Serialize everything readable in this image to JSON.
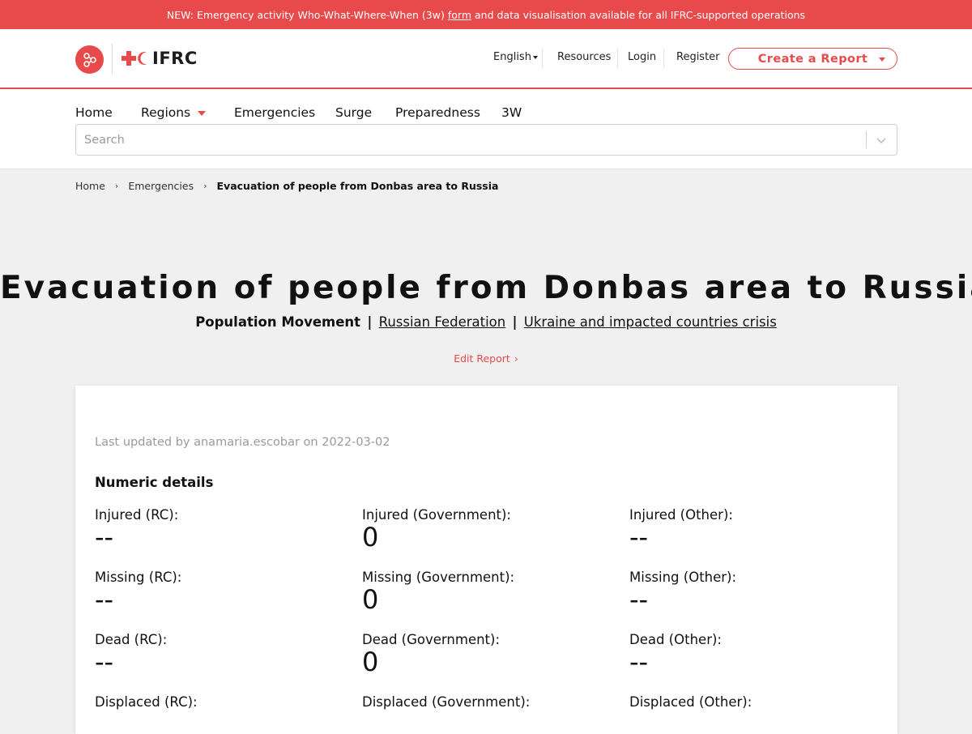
{
  "banner": {
    "prefix": "NEW: Emergency activity Who-What-Where-When (3w)",
    "link": "form",
    "suffix": "and data visualisation available for all IFRC-supported operations"
  },
  "header": {
    "logo_text": "IFRC",
    "language": "English",
    "resources": "Resources",
    "login": "Login",
    "register": "Register",
    "create_report": "Create a Report"
  },
  "nav": {
    "home": "Home",
    "regions": "Regions",
    "emergencies": "Emergencies",
    "surge": "Surge",
    "preparedness": "Preparedness",
    "threew": "3W",
    "search_placeholder": "Search"
  },
  "breadcrumb": {
    "home": "Home",
    "emergencies": "Emergencies",
    "current": "Evacuation of people from Donbas area to Russia"
  },
  "page": {
    "title": "Evacuation of people from Donbas area to Russia",
    "disaster_type": "Population Movement",
    "country": "Russian Federation",
    "appeal": "Ukraine and impacted countries crisis",
    "edit_report": "Edit Report"
  },
  "details": {
    "updated": "Last updated by anamaria.escobar on 2022-03-02",
    "section_title": "Numeric details",
    "injured_rc": {
      "label": "Injured (RC):",
      "value": "--"
    },
    "injured_gov": {
      "label": "Injured (Government):",
      "value": "0"
    },
    "injured_other": {
      "label": "Injured (Other):",
      "value": "--"
    },
    "missing_rc": {
      "label": "Missing (RC):",
      "value": "--"
    },
    "missing_gov": {
      "label": "Missing (Government):",
      "value": "0"
    },
    "missing_other": {
      "label": "Missing (Other):",
      "value": "--"
    },
    "dead_rc": {
      "label": "Dead (RC):",
      "value": "--"
    },
    "dead_gov": {
      "label": "Dead (Government):",
      "value": "0"
    },
    "dead_other": {
      "label": "Dead (Other):",
      "value": "--"
    },
    "displaced_rc": {
      "label": "Displaced (RC):"
    },
    "displaced_gov": {
      "label": "Displaced (Government):"
    },
    "displaced_other": {
      "label": "Displaced (Other):"
    }
  },
  "colors": {
    "accent": "#e84a4c"
  }
}
